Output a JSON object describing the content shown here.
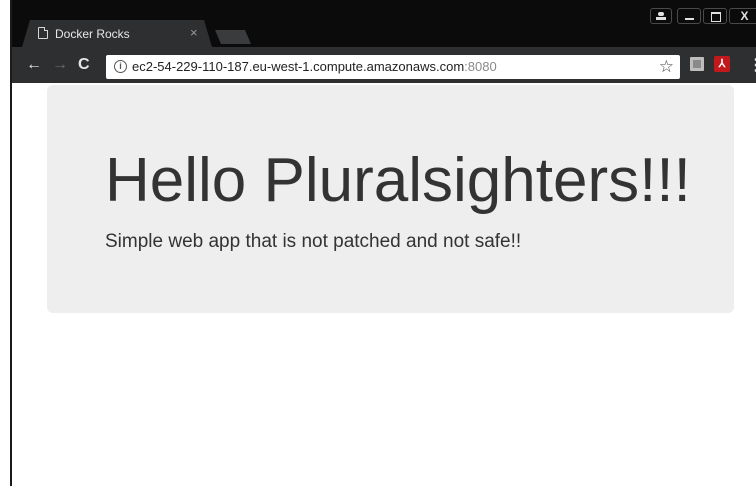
{
  "browser": {
    "tab": {
      "title": "Docker Rocks",
      "close_glyph": "×"
    },
    "window_controls": {
      "close_glyph": "X"
    },
    "toolbar": {
      "back_glyph": "←",
      "forward_glyph": "→",
      "reload_glyph": "C",
      "info_glyph": "i",
      "url_host": "ec2-54-229-110-187.eu-west-1.compute.amazonaws.com",
      "url_port": ":8080",
      "star_glyph": "☆",
      "pdf_glyph": "⅄",
      "menu_glyph": "⋮"
    }
  },
  "page": {
    "heading": "Hello Pluralsighters!!!",
    "subheading": "Simple web app that is not patched and not safe!!"
  },
  "colors": {
    "titlebar": "#0b0b0b",
    "toolbar": "#2e2f31",
    "jumbotron_bg": "#eeeeee",
    "text": "#333333",
    "pdf_icon": "#c2191c"
  }
}
